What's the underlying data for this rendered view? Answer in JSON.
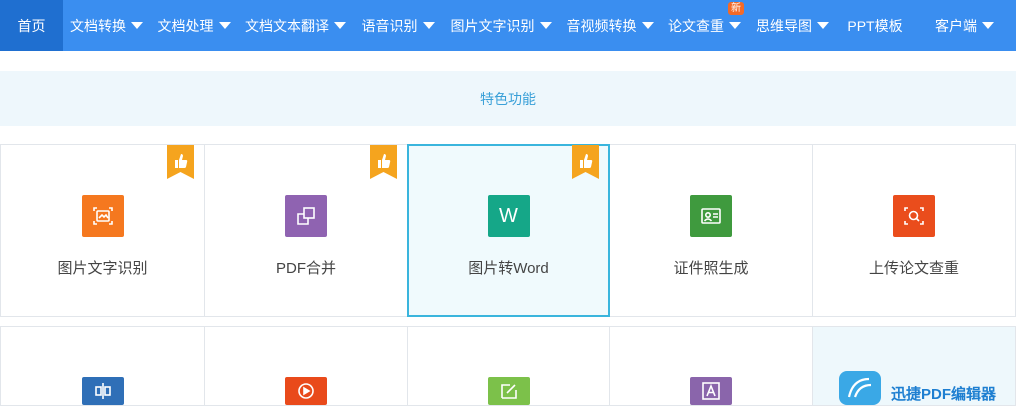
{
  "nav": {
    "items": [
      {
        "label": "首页",
        "dropdown": false
      },
      {
        "label": "文档转换",
        "dropdown": true
      },
      {
        "label": "文档处理",
        "dropdown": true
      },
      {
        "label": "文档文本翻译",
        "dropdown": true
      },
      {
        "label": "语音识别",
        "dropdown": true
      },
      {
        "label": "图片文字识别",
        "dropdown": true
      },
      {
        "label": "音视频转换",
        "dropdown": true
      },
      {
        "label": "论文查重",
        "dropdown": true,
        "badge": "新"
      },
      {
        "label": "思维导图",
        "dropdown": true
      },
      {
        "label": "PPT模板",
        "dropdown": false
      },
      {
        "label": "客户端",
        "dropdown": true
      }
    ]
  },
  "section": {
    "title": "特色功能"
  },
  "features_row1": [
    {
      "label": "图片文字识别",
      "icon": "image-scan-icon",
      "color": "#f5781f",
      "hot": true
    },
    {
      "label": "PDF合并",
      "icon": "merge-icon",
      "color": "#8f63b1",
      "hot": true
    },
    {
      "label": "图片转Word",
      "icon": "word-icon",
      "color": "#15a788",
      "hot": true,
      "active": true
    },
    {
      "label": "证件照生成",
      "icon": "id-photo-icon",
      "color": "#3f9a3e",
      "hot": false
    },
    {
      "label": "上传论文查重",
      "icon": "search-scan-icon",
      "color": "#ea4d1c",
      "hot": false
    }
  ],
  "features_row2": [
    {
      "icon": "align-icon",
      "color": "#2f6fb7"
    },
    {
      "icon": "play-icon",
      "color": "#e94a1b"
    },
    {
      "icon": "edit-icon",
      "color": "#7cc14a"
    },
    {
      "icon": "text-icon",
      "color": "#8a65ab"
    }
  ],
  "pdf_editor": {
    "name": "迅捷PDF编辑器"
  },
  "colors": {
    "nav_bg": "#3a8ef0",
    "nav_active": "#1f6fd0",
    "hot_ribbon": "#f5a41e",
    "section_text": "#3aa0d8"
  }
}
